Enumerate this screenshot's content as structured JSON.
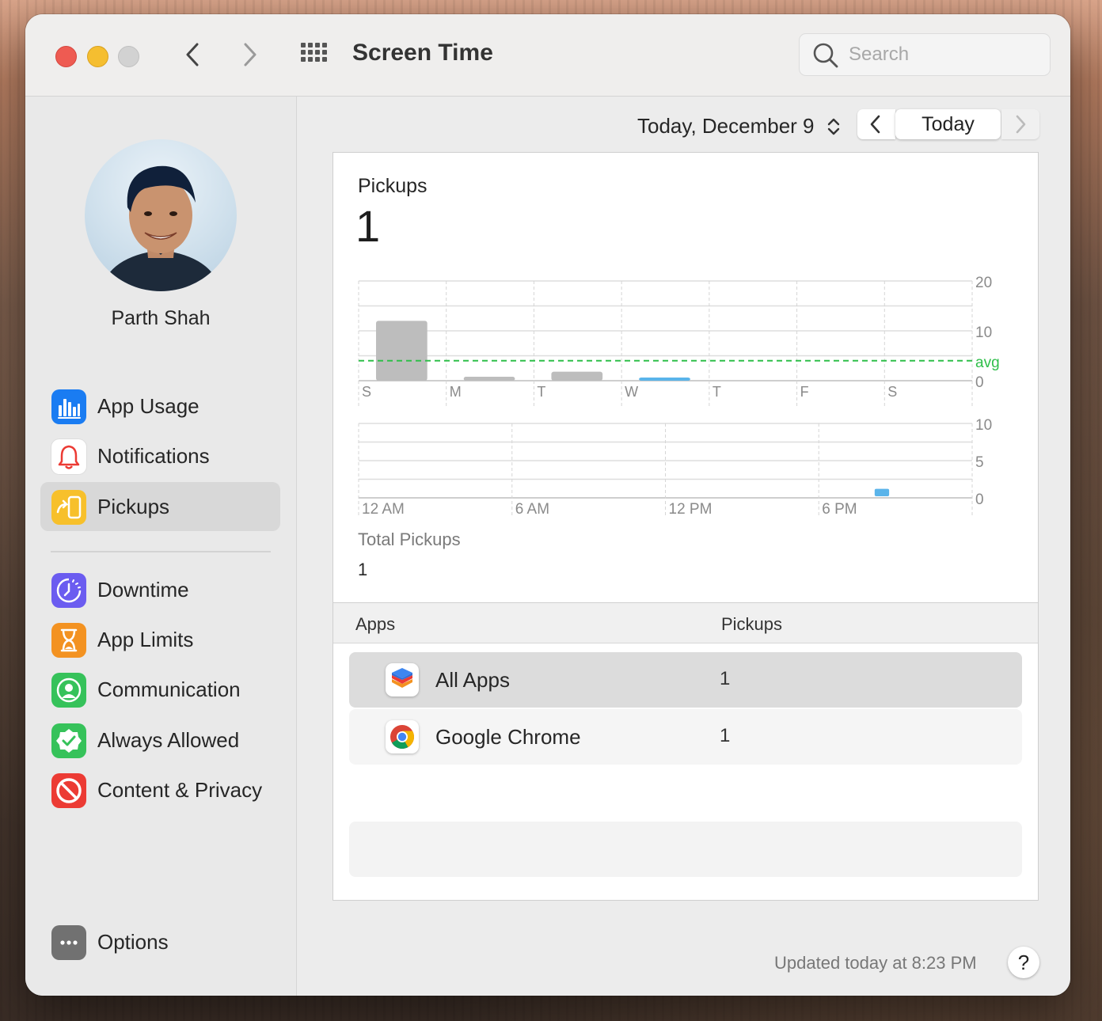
{
  "window": {
    "title": "Screen Time"
  },
  "search": {
    "placeholder": "Search"
  },
  "user": {
    "name": "Parth Shah"
  },
  "sidebar": {
    "items": [
      {
        "label": "App Usage",
        "icon": "bar-chart-icon",
        "color": "#1a7cf2"
      },
      {
        "label": "Notifications",
        "icon": "bell-icon",
        "color": "#ffffff"
      },
      {
        "label": "Pickups",
        "icon": "pickup-phone-icon",
        "color": "#f7c02b",
        "selected": true
      },
      {
        "label": "Downtime",
        "icon": "downtime-clock-icon",
        "color": "#6b5cf0"
      },
      {
        "label": "App Limits",
        "icon": "hourglass-icon",
        "color": "#f39221"
      },
      {
        "label": "Communication",
        "icon": "person-circle-icon",
        "color": "#36c25a"
      },
      {
        "label": "Always Allowed",
        "icon": "checkmark-badge-icon",
        "color": "#36c25a"
      },
      {
        "label": "Content & Privacy",
        "icon": "no-entry-icon",
        "color": "#ec3b34"
      }
    ],
    "options_label": "Options"
  },
  "date": {
    "label": "Today, December 9",
    "today_button": "Today"
  },
  "panel": {
    "title": "Pickups",
    "value": "1",
    "total_label": "Total Pickups",
    "total_value": "1"
  },
  "chart_data": [
    {
      "type": "bar",
      "categories": [
        "S",
        "M",
        "T",
        "W",
        "T",
        "F",
        "S"
      ],
      "values": [
        12,
        0.8,
        1.8,
        0.6,
        0,
        0,
        0
      ],
      "highlight_index": 3,
      "ylim": [
        0,
        20
      ],
      "yticks": [
        "20",
        "10",
        "0"
      ],
      "average": 4,
      "average_label": "avg",
      "colors": {
        "bar": "#bdbdbd",
        "highlight": "#5ab4ea",
        "avg": "#2fbf4a"
      }
    },
    {
      "type": "bar",
      "categories": [
        "12 AM",
        "6 AM",
        "12 PM",
        "6 PM"
      ],
      "hours": 24,
      "values_by_hour": [
        0,
        0,
        0,
        0,
        0,
        0,
        0,
        0,
        0,
        0,
        0,
        0,
        0,
        0,
        0,
        0,
        0,
        0,
        0,
        0,
        1,
        0,
        0,
        0
      ],
      "ylim": [
        0,
        10
      ],
      "yticks": [
        "10",
        "5",
        "0"
      ],
      "colors": {
        "bar": "#5ab4ea"
      }
    }
  ],
  "table": {
    "col_apps": "Apps",
    "col_pickups": "Pickups",
    "rows": [
      {
        "name": "All Apps",
        "value": "1",
        "icon": "stacked-layers-icon"
      },
      {
        "name": "Google Chrome",
        "value": "1",
        "icon": "chrome-icon"
      }
    ]
  },
  "footer": {
    "updated": "Updated today at 8:23 PM",
    "help": "?"
  }
}
